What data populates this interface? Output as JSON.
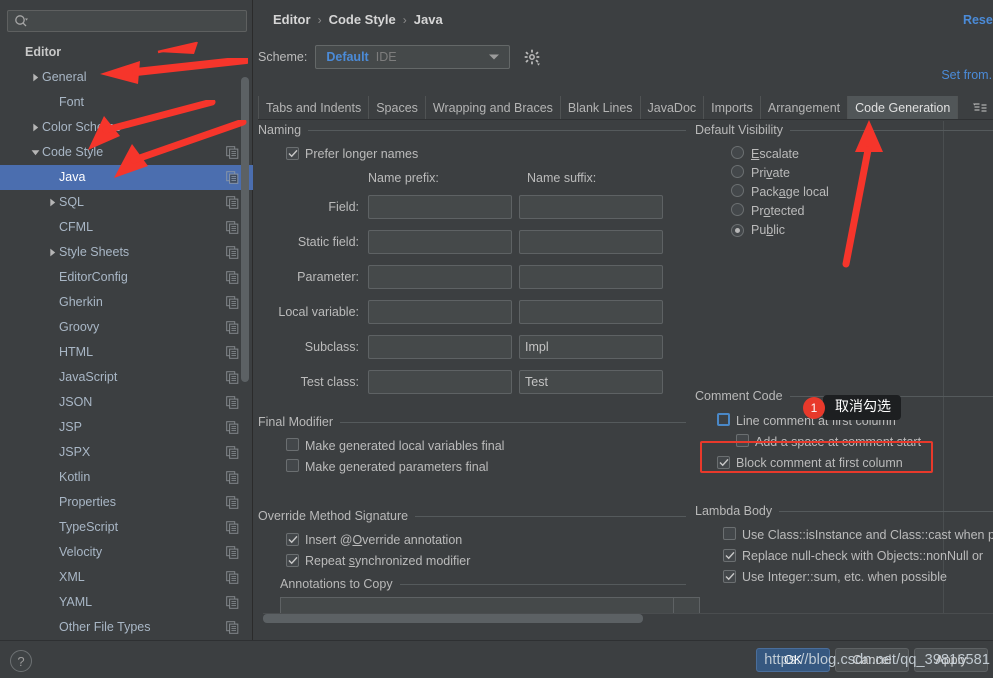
{
  "search": {
    "placeholder": "",
    "value": "",
    "icon": "search-icon"
  },
  "sidebar": {
    "items": [
      {
        "label": "Editor",
        "indent": 0,
        "arrow": "none",
        "bold": true,
        "copy": false,
        "selected": false
      },
      {
        "label": "General",
        "indent": 1,
        "arrow": "collapsed",
        "bold": false,
        "copy": false,
        "selected": false
      },
      {
        "label": "Font",
        "indent": 2,
        "arrow": "none",
        "bold": false,
        "copy": false,
        "selected": false
      },
      {
        "label": "Color Scheme",
        "indent": 1,
        "arrow": "collapsed",
        "bold": false,
        "copy": false,
        "selected": false
      },
      {
        "label": "Code Style",
        "indent": 1,
        "arrow": "expanded",
        "bold": false,
        "copy": true,
        "selected": false
      },
      {
        "label": "Java",
        "indent": 2,
        "arrow": "none",
        "bold": false,
        "copy": true,
        "selected": true
      },
      {
        "label": "SQL",
        "indent": 2,
        "arrow": "collapsed",
        "bold": false,
        "copy": true,
        "selected": false
      },
      {
        "label": "CFML",
        "indent": 2,
        "arrow": "none",
        "bold": false,
        "copy": true,
        "selected": false
      },
      {
        "label": "Style Sheets",
        "indent": 2,
        "arrow": "collapsed",
        "bold": false,
        "copy": true,
        "selected": false
      },
      {
        "label": "EditorConfig",
        "indent": 2,
        "arrow": "none",
        "bold": false,
        "copy": true,
        "selected": false
      },
      {
        "label": "Gherkin",
        "indent": 2,
        "arrow": "none",
        "bold": false,
        "copy": true,
        "selected": false
      },
      {
        "label": "Groovy",
        "indent": 2,
        "arrow": "none",
        "bold": false,
        "copy": true,
        "selected": false
      },
      {
        "label": "HTML",
        "indent": 2,
        "arrow": "none",
        "bold": false,
        "copy": true,
        "selected": false
      },
      {
        "label": "JavaScript",
        "indent": 2,
        "arrow": "none",
        "bold": false,
        "copy": true,
        "selected": false
      },
      {
        "label": "JSON",
        "indent": 2,
        "arrow": "none",
        "bold": false,
        "copy": true,
        "selected": false
      },
      {
        "label": "JSP",
        "indent": 2,
        "arrow": "none",
        "bold": false,
        "copy": true,
        "selected": false
      },
      {
        "label": "JSPX",
        "indent": 2,
        "arrow": "none",
        "bold": false,
        "copy": true,
        "selected": false
      },
      {
        "label": "Kotlin",
        "indent": 2,
        "arrow": "none",
        "bold": false,
        "copy": true,
        "selected": false
      },
      {
        "label": "Properties",
        "indent": 2,
        "arrow": "none",
        "bold": false,
        "copy": true,
        "selected": false
      },
      {
        "label": "TypeScript",
        "indent": 2,
        "arrow": "none",
        "bold": false,
        "copy": true,
        "selected": false
      },
      {
        "label": "Velocity",
        "indent": 2,
        "arrow": "none",
        "bold": false,
        "copy": true,
        "selected": false
      },
      {
        "label": "XML",
        "indent": 2,
        "arrow": "none",
        "bold": false,
        "copy": true,
        "selected": false
      },
      {
        "label": "YAML",
        "indent": 2,
        "arrow": "none",
        "bold": false,
        "copy": true,
        "selected": false
      },
      {
        "label": "Other File Types",
        "indent": 2,
        "arrow": "none",
        "bold": false,
        "copy": true,
        "selected": false
      }
    ]
  },
  "header": {
    "breadcrumb": [
      "Editor",
      "Code Style",
      "Java"
    ],
    "separator": "›",
    "reset_label": "Reset",
    "set_from_label": "Set from...",
    "scheme_label": "Scheme:",
    "scheme_value": "Default",
    "scheme_suffix": "IDE",
    "gear_icon": "gear-icon"
  },
  "tabs": [
    {
      "label": "Tabs and Indents",
      "active": false
    },
    {
      "label": "Spaces",
      "active": false
    },
    {
      "label": "Wrapping and Braces",
      "active": false
    },
    {
      "label": "Blank Lines",
      "active": false
    },
    {
      "label": "JavaDoc",
      "active": false
    },
    {
      "label": "Imports",
      "active": false
    },
    {
      "label": "Arrangement",
      "active": false
    },
    {
      "label": "Code Generation",
      "active": true
    }
  ],
  "naming": {
    "title": "Naming",
    "prefer_longer_names": {
      "label": "Prefer longer names",
      "checked": true
    },
    "col_prefix": "Name prefix:",
    "col_suffix": "Name suffix:",
    "rows": [
      {
        "label": "Field:",
        "prefix": "",
        "suffix": ""
      },
      {
        "label": "Static field:",
        "prefix": "",
        "suffix": ""
      },
      {
        "label": "Parameter:",
        "prefix": "",
        "suffix": ""
      },
      {
        "label": "Local variable:",
        "prefix": "",
        "suffix": ""
      },
      {
        "label": "Subclass:",
        "prefix": "",
        "suffix": "Impl"
      },
      {
        "label": "Test class:",
        "prefix": "",
        "suffix": "Test"
      }
    ]
  },
  "final_modifier": {
    "title": "Final Modifier",
    "options": [
      {
        "label": "Make generated local variables final",
        "checked": false
      },
      {
        "label": "Make generated parameters final",
        "checked": false
      }
    ]
  },
  "override_signature": {
    "title": "Override Method Signature",
    "options": [
      {
        "pre": "Insert @",
        "mnemonic": "O",
        "post": "verride annotation",
        "checked": true
      },
      {
        "pre": "Repeat ",
        "mnemonic": "s",
        "post": "ynchronized modifier",
        "checked": true
      }
    ]
  },
  "annotations_to_copy": {
    "title": "Annotations to Copy"
  },
  "default_visibility": {
    "title": "Default Visibility",
    "options": [
      {
        "pre": "",
        "mnemonic": "E",
        "post": "scalate",
        "checked": false
      },
      {
        "pre": "Pri",
        "mnemonic": "v",
        "post": "ate",
        "checked": false
      },
      {
        "pre": "Pack",
        "mnemonic": "a",
        "post": "ge local",
        "checked": false
      },
      {
        "pre": "Pr",
        "mnemonic": "o",
        "post": "tected",
        "checked": false
      },
      {
        "pre": "Pu",
        "mnemonic": "b",
        "post": "lic",
        "checked": true
      }
    ]
  },
  "comment_code": {
    "title": "Comment Code",
    "options": [
      {
        "label": "Line comment at first column",
        "checked": false,
        "focused": true,
        "indent": 0
      },
      {
        "label": "Add a space at comment start",
        "checked": false,
        "focused": false,
        "indent": 1
      },
      {
        "label": "Block comment at first column",
        "checked": true,
        "focused": false,
        "indent": 0
      }
    ]
  },
  "lambda_body": {
    "title": "Lambda Body",
    "options": [
      {
        "label": "Use Class::isInstance and Class::cast when p",
        "checked": false
      },
      {
        "label": "Replace null-check with Objects::nonNull or",
        "checked": true
      },
      {
        "label": "Use Integer::sum, etc. when possible",
        "checked": true
      }
    ]
  },
  "annotation": {
    "badge_number": "1",
    "callout_text": "取消勾选",
    "highlight_color": "#e8392b"
  },
  "footer": {
    "help_label": "?",
    "ok_label": "OK",
    "cancel_label": "Cancel",
    "apply_label": "Apply",
    "watermark": "https://blog.csdn.net/qq_39816581"
  }
}
